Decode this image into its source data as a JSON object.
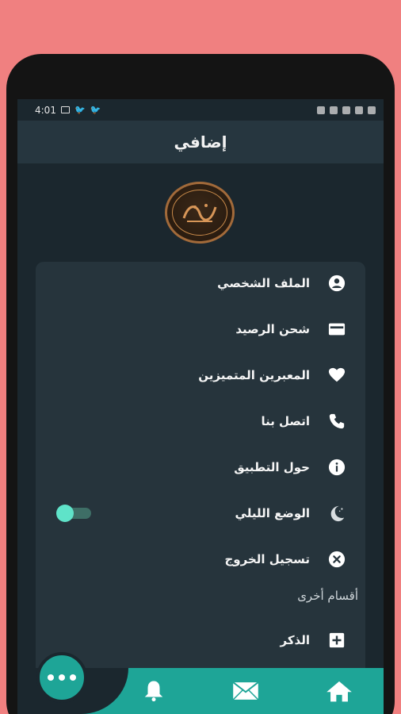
{
  "statusbar": {
    "time": "4:01"
  },
  "appbar": {
    "title": "إضافي"
  },
  "logo": {
    "text": "تفسير الأحلام"
  },
  "menu": [
    {
      "label": "الملف الشخصي",
      "icon": "account-circle-icon"
    },
    {
      "label": "شحن الرصيد",
      "icon": "credit-card-icon"
    },
    {
      "label": "المعبرين المتميزين",
      "icon": "heart-icon"
    },
    {
      "label": "اتصل بنا",
      "icon": "phone-icon"
    },
    {
      "label": "حول التطبيق",
      "icon": "info-icon"
    },
    {
      "label": "الوضع الليلي",
      "icon": "moon-icon",
      "toggle": true
    },
    {
      "label": "تسجيل الخروج",
      "icon": "close-circle-icon"
    }
  ],
  "other_sections": {
    "title": "أقسام أخرى",
    "items": [
      {
        "label": "الذكر",
        "icon": "plus-box-icon"
      }
    ]
  },
  "bottom_nav": {
    "items": [
      "bell-icon",
      "mail-icon",
      "home-icon"
    ],
    "fab": "more-icon"
  },
  "colors": {
    "accent": "#1ea597",
    "background": "#1b272e",
    "card": "#26343c",
    "toggle_knob": "#5fe3c9"
  }
}
